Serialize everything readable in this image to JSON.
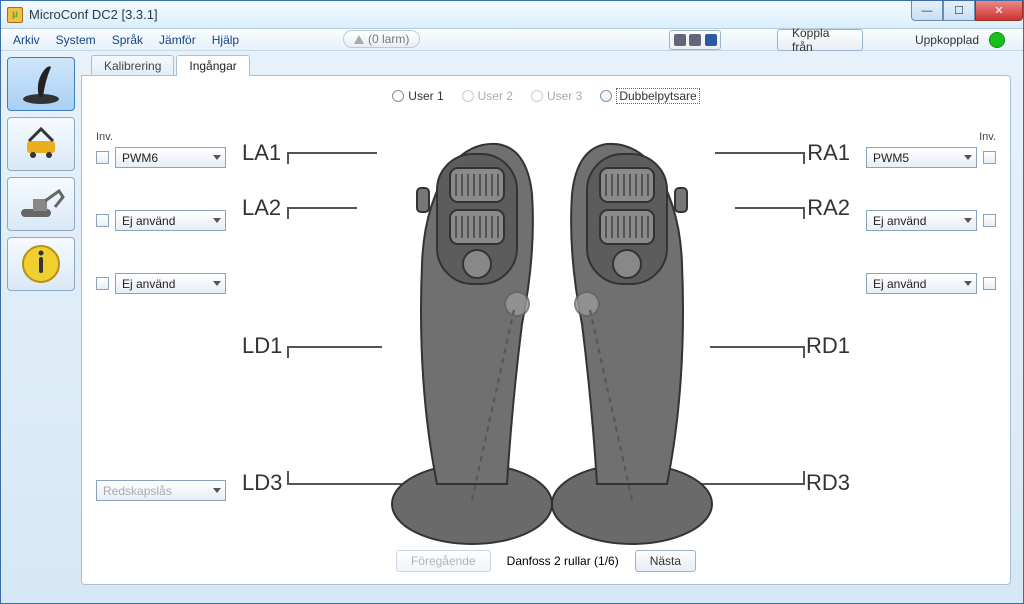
{
  "window": {
    "title": "MicroConf DC2 [3.3.1]"
  },
  "menu": {
    "arkiv": "Arkiv",
    "system": "System",
    "sprak": "Språk",
    "jamfor": "Jämför",
    "hjalp": "Hjälp"
  },
  "toolbar": {
    "alarm": "(0 larm)",
    "disconnect": "Koppla från",
    "status": "Uppkopplad"
  },
  "tabs": {
    "kalibrering": "Kalibrering",
    "ingangar": "Ingångar"
  },
  "users": {
    "u1": "User 1",
    "u2": "User 2",
    "u3": "User 3",
    "dubbel": "Dubbelpytsare"
  },
  "inv_label": "Inv.",
  "left": {
    "la1": {
      "label": "LA1",
      "value": "PWM6"
    },
    "la2": {
      "label": "LA2",
      "value": "Ej använd"
    },
    "la3": {
      "value": "Ej använd"
    },
    "ld1": {
      "label": "LD1"
    },
    "ld3": {
      "label": "LD3",
      "value": "Redskapslås"
    }
  },
  "right": {
    "ra1": {
      "label": "RA1",
      "value": "PWM5"
    },
    "ra2": {
      "label": "RA2",
      "value": "Ej använd"
    },
    "ra3": {
      "value": "Ej använd"
    },
    "rd1": {
      "label": "RD1"
    },
    "rd3": {
      "label": "RD3"
    }
  },
  "bottom": {
    "prev": "Föregående",
    "model": "Danfoss 2 rullar (1/6)",
    "next": "Nästa"
  }
}
